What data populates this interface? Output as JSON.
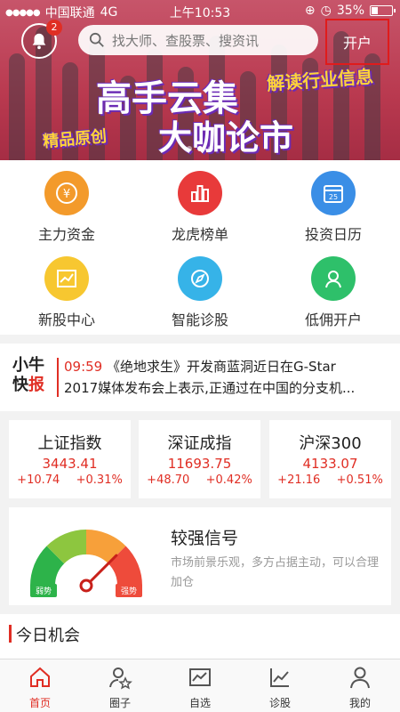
{
  "status_bar": {
    "carrier": "中国联通",
    "network": "4G",
    "time": "上午10:53",
    "battery": "35%",
    "battery_level": 0.35
  },
  "header": {
    "notification_count": "2",
    "search_placeholder": "找大师、查股票、搜资讯",
    "open_account": "开户"
  },
  "banner": {
    "headline_1": "高手云集",
    "headline_2": "大咖论市",
    "tag_right": "解读行业信息",
    "tag_left": "精品原创",
    "slide_count": 3,
    "active_slide": 2
  },
  "grid": [
    {
      "label": "主力资金",
      "icon": "yen-coin-icon",
      "color": "#f39a2b"
    },
    {
      "label": "龙虎榜单",
      "icon": "bar-chart-icon",
      "color": "#e83a3a"
    },
    {
      "label": "投资日历",
      "icon": "calendar-icon",
      "color": "#3a8ee6",
      "day": "25"
    },
    {
      "label": "新股中心",
      "icon": "trend-chart-icon",
      "color": "#f7c730"
    },
    {
      "label": "智能诊股",
      "icon": "compass-icon",
      "color": "#36b3e8"
    },
    {
      "label": "低佣开户",
      "icon": "user-icon",
      "color": "#2ec06a"
    }
  ],
  "flash_news": {
    "logo_line_1": "小牛",
    "logo_line_2a": "快",
    "logo_line_2b": "报",
    "time": "09:59",
    "line_1": "《绝地求生》开发商蓝洞近日在G-Star",
    "line_2": "2017媒体发布会上表示,正通过在中国的分支机..."
  },
  "indices": [
    {
      "name": "上证指数",
      "value": "3443.41",
      "change": "+10.74",
      "percent": "+0.31%"
    },
    {
      "name": "深证成指",
      "value": "11693.75",
      "change": "+48.70",
      "percent": "+0.42%"
    },
    {
      "name": "沪深300",
      "value": "4133.07",
      "change": "+21.16",
      "percent": "+0.51%"
    }
  ],
  "signal": {
    "title": "较强信号",
    "description": "市场前景乐观，多方占据主动，可以合理加仓",
    "weak_label": "弱势",
    "strong_label": "强势",
    "level": 0.75
  },
  "today": {
    "title": "今日机会"
  },
  "tabs": [
    {
      "label": "首页",
      "icon": "home-icon",
      "active": true
    },
    {
      "label": "圈子",
      "icon": "user-star-icon",
      "active": false
    },
    {
      "label": "自选",
      "icon": "chart-window-icon",
      "active": false
    },
    {
      "label": "诊股",
      "icon": "trend-line-icon",
      "active": false
    },
    {
      "label": "我的",
      "icon": "person-icon",
      "active": false
    }
  ]
}
